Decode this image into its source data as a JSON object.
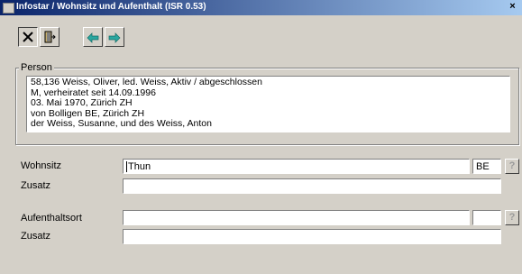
{
  "window": {
    "title": "Infostar / Wohnsitz und Aufenthalt (ISR 0.53)",
    "close_glyph": "×"
  },
  "toolbar": {
    "close_icon": "close-icon",
    "exit_icon": "exit-door-icon",
    "back_icon": "arrow-left-icon",
    "forward_icon": "arrow-right-icon"
  },
  "person": {
    "group_label": "Person",
    "lines": [
      "58,136  Weiss, Oliver, led. Weiss, Aktiv / abgeschlossen",
      "M, verheiratet seit 14.09.1996",
      "03. Mai 1970, Zürich ZH",
      "von Bolligen BE, Zürich ZH",
      "der Weiss, Susanne,  und des Weiss, Anton"
    ]
  },
  "wohnsitz": {
    "label": "Wohnsitz",
    "value": "Thun",
    "canton": "BE",
    "help": "?"
  },
  "wohnsitz_zusatz": {
    "label": "Zusatz",
    "value": ""
  },
  "aufenthalt": {
    "label": "Aufenthaltsort",
    "value": "",
    "canton": "",
    "help": "?"
  },
  "aufenthalt_zusatz": {
    "label": "Zusatz",
    "value": ""
  }
}
